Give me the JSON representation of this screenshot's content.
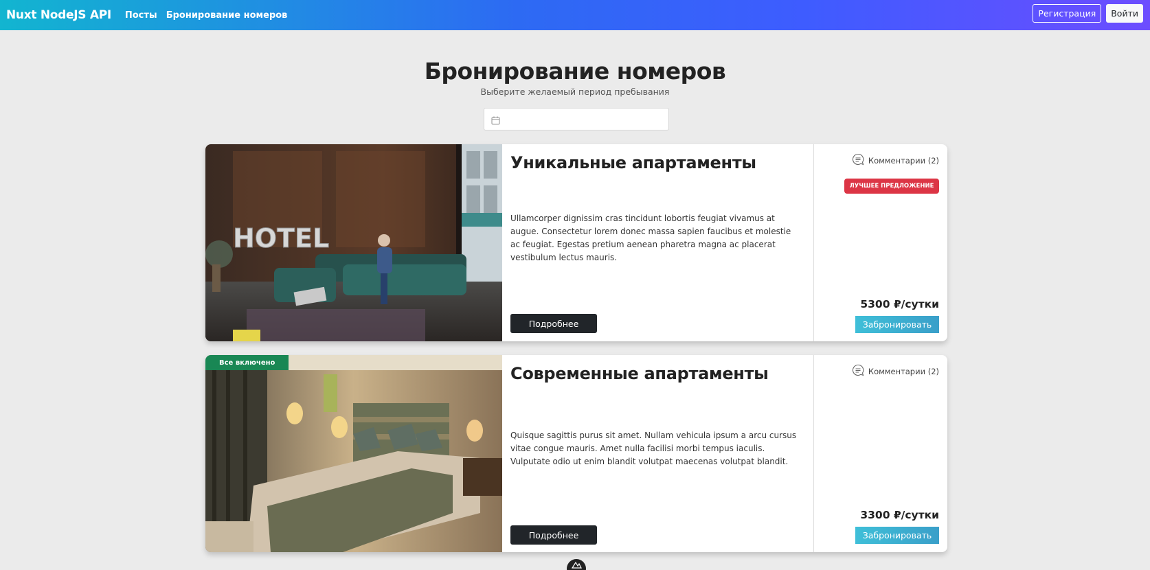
{
  "navbar": {
    "brand": "Nuxt NodeJS API",
    "links": [
      "Посты",
      "Бронирование номеров"
    ],
    "register": "Регистрация",
    "login": "Войти"
  },
  "header": {
    "title": "Бронирование номеров",
    "subtitle": "Выберите желаемый период пребывания",
    "date_value": ""
  },
  "rooms": [
    {
      "title": "Уникальные апартаменты",
      "description": "Ullamcorper dignissim cras tincidunt lobortis feugiat vivamus at augue. Consectetur lorem donec massa sapien faucibus et molestie ac feugiat. Egestas pretium aenean pharetra magna ac placerat vestibulum lectus mauris.",
      "details_label": "Подробнее",
      "comments": "Комментарии (2)",
      "badge": "ЛУЧШЕЕ ПРЕДЛОЖЕНИЕ",
      "image_badge": "",
      "price": "5300 ₽/сутки",
      "book_label": "Забронировать",
      "image_alt": "Лобби отеля"
    },
    {
      "title": "Современные апартаменты",
      "description": "Quisque sagittis purus sit amet. Nullam vehicula ipsum a arcu cursus vitae congue mauris. Amet nulla facilisi morbi tempus iaculis. Vulputate odio ut enim blandit volutpat maecenas volutpat blandit.",
      "details_label": "Подробнее",
      "comments": "Комментарии (2)",
      "badge": "",
      "image_badge": "Все включено",
      "price": "3300 ₽/сутки",
      "book_label": "Забронировать",
      "image_alt": "Номер отеля"
    }
  ],
  "colors": {
    "badge_red": "#dc3545",
    "badge_green": "#198754",
    "book_button": "#3fbfd8",
    "dark_button": "#212529"
  }
}
